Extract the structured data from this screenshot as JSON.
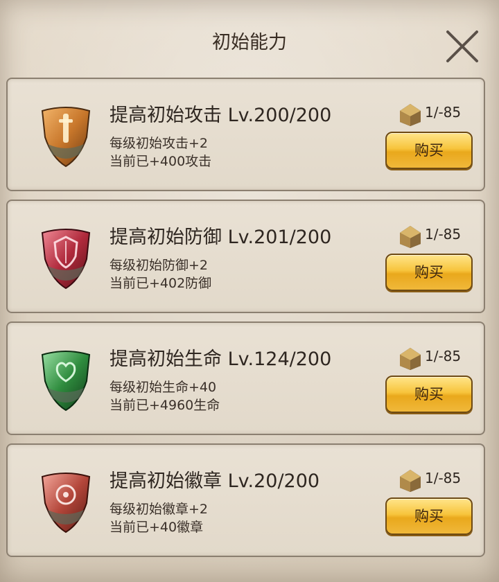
{
  "title": "初始能力",
  "items": [
    {
      "name": "提高初始攻击 Lv.200/200",
      "desc": "每级初始攻击+2",
      "current": "当前已+400攻击",
      "cost": "1/-85",
      "buy": "购买",
      "gem_color": "#c8772b",
      "gem_icon": "sword-gem-icon"
    },
    {
      "name": "提高初始防御 Lv.201/200",
      "desc": "每级初始防御+2",
      "current": "当前已+402防御",
      "cost": "1/-85",
      "buy": "购买",
      "gem_color": "#b02a3c",
      "gem_icon": "shield-gem-icon"
    },
    {
      "name": "提高初始生命 Lv.124/200",
      "desc": "每级初始生命+40",
      "current": "当前已+4960生命",
      "cost": "1/-85",
      "buy": "购买",
      "gem_color": "#2f8c3e",
      "gem_icon": "life-gem-icon"
    },
    {
      "name": "提高初始徽章 Lv.20/200",
      "desc": "每级初始徽章+2",
      "current": "当前已+40徽章",
      "cost": "1/-85",
      "buy": "购买",
      "gem_color": "#b3463a",
      "gem_icon": "badge-gem-icon"
    }
  ]
}
